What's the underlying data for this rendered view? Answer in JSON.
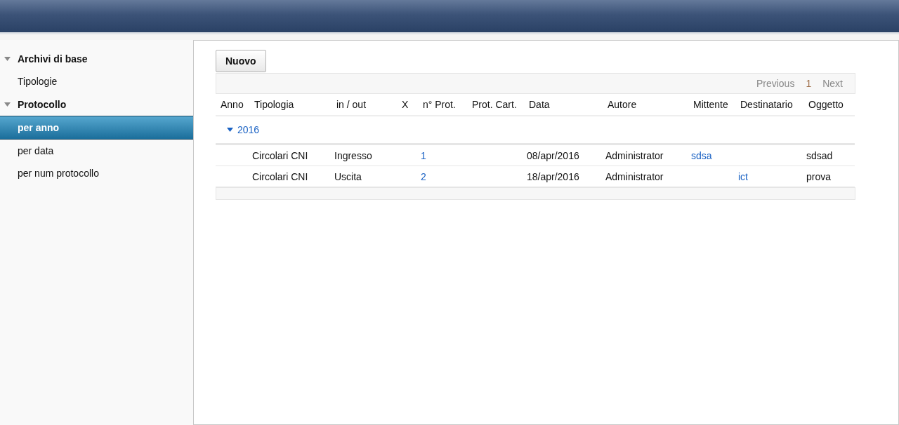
{
  "sidebar": {
    "groups": [
      {
        "label": "Archivi di base",
        "expanded": true,
        "items": [
          {
            "label": "Tipologie",
            "selected": false
          }
        ]
      },
      {
        "label": "Protocollo",
        "expanded": true,
        "items": [
          {
            "label": "per anno",
            "selected": true
          },
          {
            "label": "per data",
            "selected": false
          },
          {
            "label": "per num protocollo",
            "selected": false
          }
        ]
      }
    ]
  },
  "toolbar": {
    "new_button": "Nuovo"
  },
  "pager": {
    "previous": {
      "label": "Previous",
      "disabled": true
    },
    "pages": [
      {
        "label": "1",
        "selected": true
      }
    ],
    "next": {
      "label": "Next",
      "disabled": true
    }
  },
  "table": {
    "columns": [
      "Anno",
      "Tipologia",
      "in / out",
      "X",
      "n° Prot.",
      "Prot. Cart.",
      "Data",
      "Autore",
      "Mittente",
      "Destinatario",
      "Oggetto"
    ],
    "groups": [
      {
        "label": "2016",
        "expanded": true,
        "rows": [
          {
            "tipologia": {
              "text": "Circolari CNI",
              "link": false
            },
            "in_out": {
              "text": "Ingresso",
              "link": false
            },
            "n_prot": {
              "text": "1",
              "link": true
            },
            "data": {
              "text": "08/apr/2016",
              "link": false
            },
            "autore": {
              "text": "Administrator",
              "link": false
            },
            "mittente": {
              "text": "sdsa",
              "link": true
            },
            "oggetto": {
              "text": "sdsad",
              "link": false
            }
          },
          {
            "tipologia": {
              "text": "Circolari CNI",
              "link": false
            },
            "in_out": {
              "text": "Uscita",
              "link": false
            },
            "n_prot": {
              "text": "2",
              "link": true
            },
            "data": {
              "text": "18/apr/2016",
              "link": false
            },
            "autore": {
              "text": "Administrator",
              "link": false
            },
            "destinatario": {
              "text": "ict",
              "link": true
            },
            "oggetto": {
              "text": "prova",
              "link": false
            }
          }
        ]
      }
    ]
  }
}
